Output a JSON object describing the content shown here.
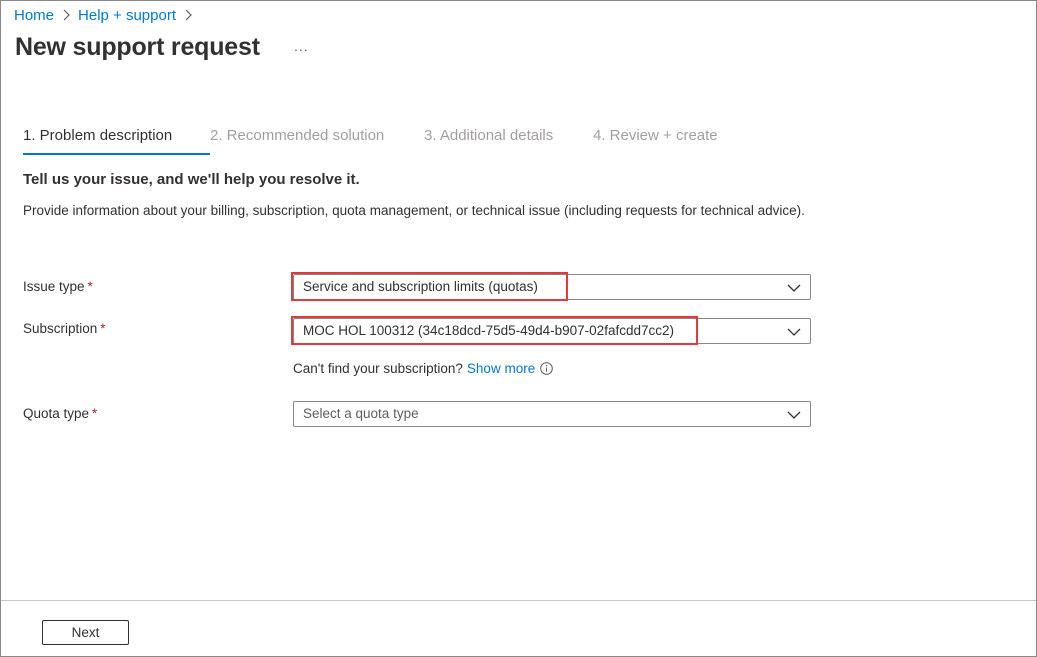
{
  "breadcrumb": {
    "items": [
      {
        "label": "Home"
      },
      {
        "label": "Help + support"
      }
    ]
  },
  "page": {
    "title": "New support request",
    "more_label": "..."
  },
  "tabs": [
    {
      "label": "1. Problem description",
      "active": true
    },
    {
      "label": "2. Recommended solution",
      "active": false
    },
    {
      "label": "3. Additional details",
      "active": false
    },
    {
      "label": "4. Review + create",
      "active": false
    }
  ],
  "content": {
    "heading": "Tell us your issue, and we'll help you resolve it.",
    "description": "Provide information about your billing, subscription, quota management, or technical issue (including requests for technical advice)."
  },
  "form": {
    "issue_type": {
      "label": "Issue type",
      "required_mark": "*",
      "value": "Service and subscription limits (quotas)"
    },
    "subscription": {
      "label": "Subscription",
      "required_mark": "*",
      "value": "MOC HOL 100312 (34c18dcd-75d5-49d4-b907-02fafcdd7cc2)"
    },
    "subscription_help": {
      "text": "Can't find your subscription?",
      "link": "Show more"
    },
    "quota_type": {
      "label": "Quota type",
      "required_mark": "*",
      "placeholder": "Select a quota type"
    }
  },
  "footer": {
    "next_label": "Next"
  },
  "colors": {
    "accent": "#0078d4",
    "required": "#a4262c",
    "highlight": "#e03b3b"
  }
}
